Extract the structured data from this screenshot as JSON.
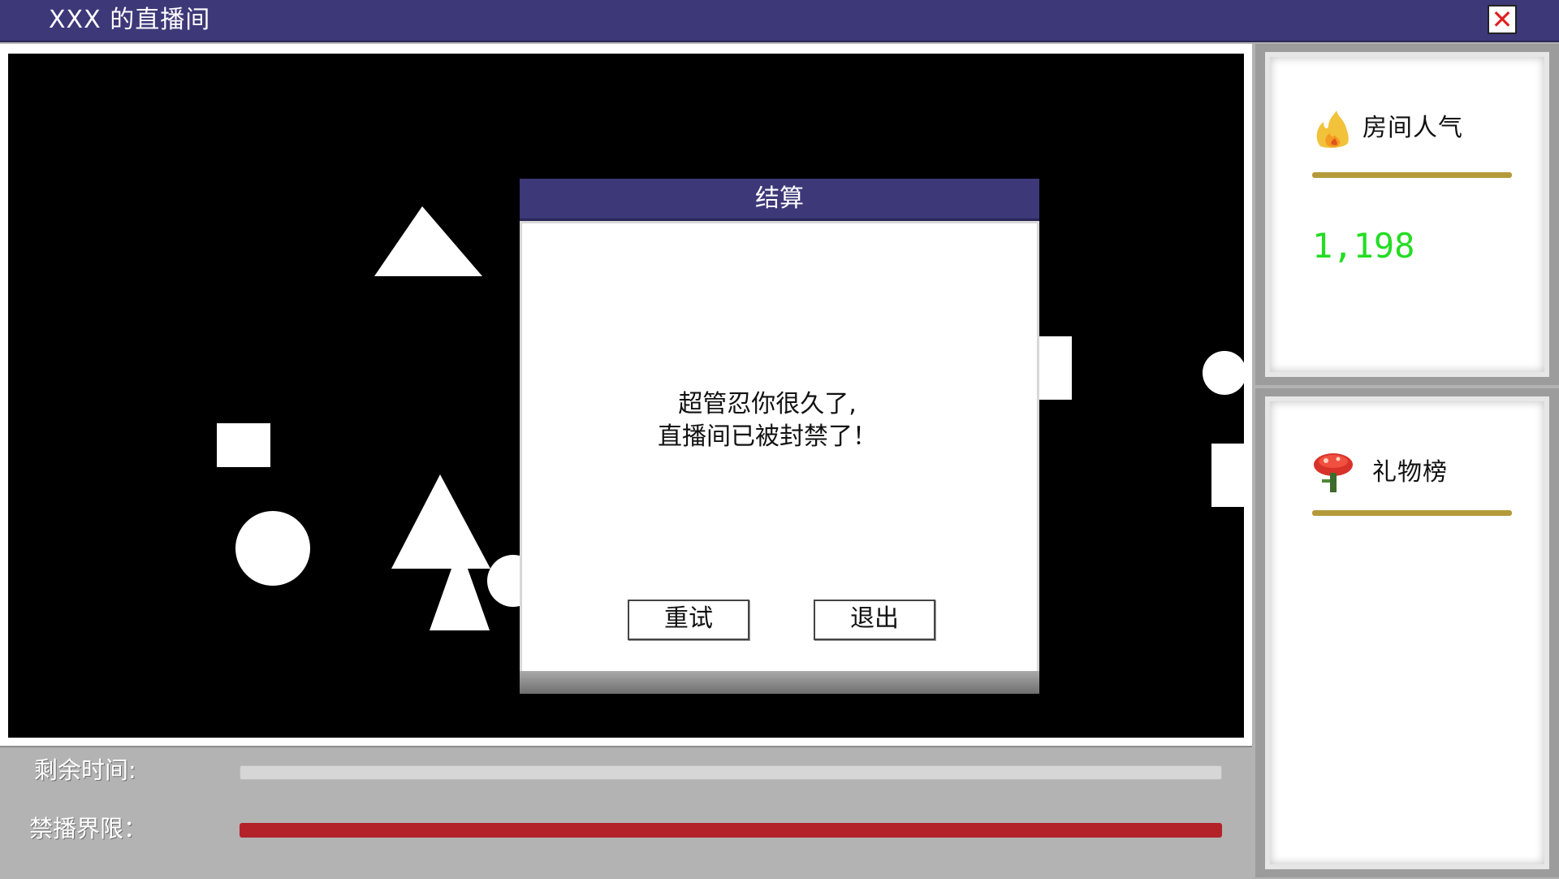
{
  "window": {
    "title": "XXX 的直播间",
    "close_glyph": "✕"
  },
  "stream": {
    "shapes_description_colors": {
      "background": "#000000",
      "shape": "#ffffff"
    }
  },
  "status_bars": {
    "time_label": "剩余时间:",
    "time_remaining_fraction": 0.0,
    "ban_label": "禁播界限：",
    "ban_fraction": 1.0,
    "ban_color": "#b22228"
  },
  "side": {
    "popularity": {
      "icon": "fire-icon",
      "title": "房间人气",
      "value": "1,198",
      "value_color": "#22dd22"
    },
    "gifts": {
      "icon": "mushroom-flower-icon",
      "title": "礼物榜"
    }
  },
  "dialog": {
    "title": "结算",
    "message_line1": "超管忍你很久了,",
    "message_line2": "直播间已被封禁了！",
    "retry_label": "重试",
    "quit_label": "退出"
  },
  "colors": {
    "titlebar": "#3d3878",
    "gold_rule": "#b59a3a"
  }
}
